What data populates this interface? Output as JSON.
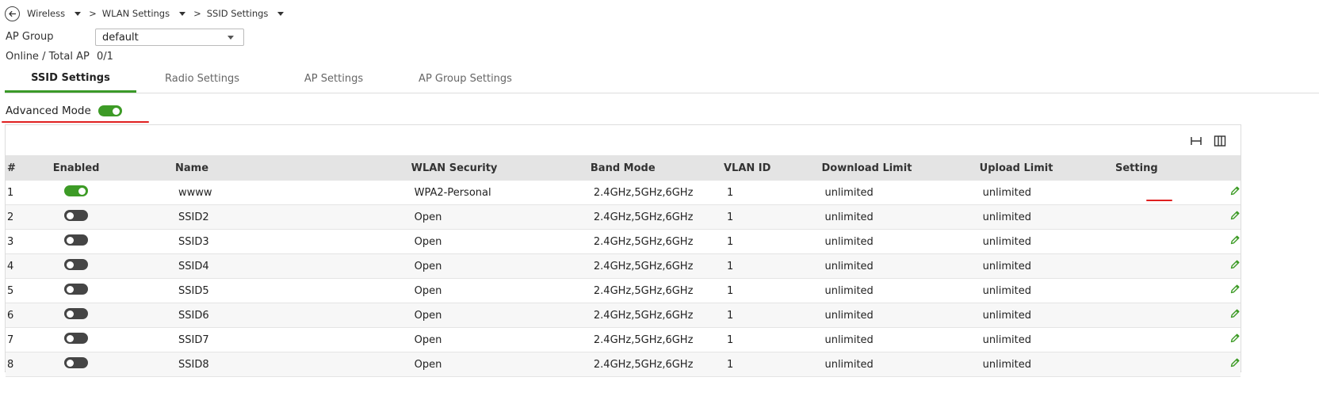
{
  "breadcrumb": {
    "items": [
      "Wireless",
      "WLAN Settings",
      "SSID Settings"
    ],
    "separator": ">"
  },
  "ap_group": {
    "label": "AP Group",
    "value": "default"
  },
  "online_total": {
    "label": "Online / Total AP",
    "value": "0/1"
  },
  "tabs": [
    "SSID Settings",
    "Radio Settings",
    "AP Settings",
    "AP Group Settings"
  ],
  "active_tab": "SSID Settings",
  "advanced_mode": {
    "label": "Advanced Mode",
    "enabled": true
  },
  "table": {
    "columns": [
      "#",
      "Enabled",
      "Name",
      "WLAN Security",
      "Band Mode",
      "VLAN ID",
      "Download Limit",
      "Upload Limit",
      "Setting"
    ],
    "rows": [
      {
        "num": "1",
        "enabled": true,
        "name": "wwww",
        "security": "WPA2-Personal",
        "band": "2.4GHz,5GHz,6GHz",
        "vlan": "1",
        "download": "unlimited",
        "upload": "unlimited"
      },
      {
        "num": "2",
        "enabled": false,
        "name": "SSID2",
        "security": "Open",
        "band": "2.4GHz,5GHz,6GHz",
        "vlan": "1",
        "download": "unlimited",
        "upload": "unlimited"
      },
      {
        "num": "3",
        "enabled": false,
        "name": "SSID3",
        "security": "Open",
        "band": "2.4GHz,5GHz,6GHz",
        "vlan": "1",
        "download": "unlimited",
        "upload": "unlimited"
      },
      {
        "num": "4",
        "enabled": false,
        "name": "SSID4",
        "security": "Open",
        "band": "2.4GHz,5GHz,6GHz",
        "vlan": "1",
        "download": "unlimited",
        "upload": "unlimited"
      },
      {
        "num": "5",
        "enabled": false,
        "name": "SSID5",
        "security": "Open",
        "band": "2.4GHz,5GHz,6GHz",
        "vlan": "1",
        "download": "unlimited",
        "upload": "unlimited"
      },
      {
        "num": "6",
        "enabled": false,
        "name": "SSID6",
        "security": "Open",
        "band": "2.4GHz,5GHz,6GHz",
        "vlan": "1",
        "download": "unlimited",
        "upload": "unlimited"
      },
      {
        "num": "7",
        "enabled": false,
        "name": "SSID7",
        "security": "Open",
        "band": "2.4GHz,5GHz,6GHz",
        "vlan": "1",
        "download": "unlimited",
        "upload": "unlimited"
      },
      {
        "num": "8",
        "enabled": false,
        "name": "SSID8",
        "security": "Open",
        "band": "2.4GHz,5GHz,6GHz",
        "vlan": "1",
        "download": "unlimited",
        "upload": "unlimited"
      }
    ]
  },
  "colors": {
    "accent_green": "#3d9b26",
    "toggle_off": "#454545",
    "annotation_red": "#e02020"
  },
  "icons": {
    "back": "arrow-left-circle-icon",
    "edit": "pencil-icon",
    "fit_width": "fit-width-icon",
    "columns": "columns-icon"
  }
}
